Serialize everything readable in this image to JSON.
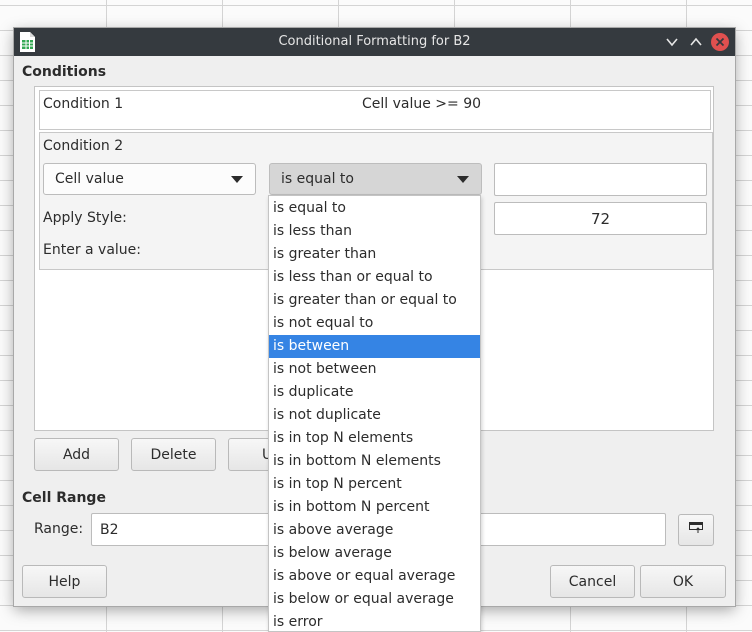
{
  "dialog": {
    "title": "Conditional Formatting for B2",
    "colors": {
      "titlebar": "#353a3f",
      "close": "#e0504f",
      "selection": "#3584e4"
    }
  },
  "conditions": {
    "heading": "Conditions",
    "condition1": {
      "label": "Condition 1",
      "summary": "Cell value >= 90"
    },
    "condition2": {
      "label": "Condition 2",
      "type_combo": "Cell value",
      "operator_combo": "is equal to",
      "value_field": "",
      "apply_style_label": "Apply Style:",
      "enter_value_label": "Enter a value:",
      "value2_field": "72"
    },
    "operator_options": [
      "is equal to",
      "is less than",
      "is greater than",
      "is less than or equal to",
      "is greater than or equal to",
      "is not equal to",
      "is between",
      "is not between",
      "is duplicate",
      "is not duplicate",
      "is in top N elements",
      "is in bottom N elements",
      "is in top N percent",
      "is in bottom N percent",
      "is above average",
      "is below average",
      "is above or equal average",
      "is below or equal average",
      "is error"
    ],
    "selected_option": "is between"
  },
  "actions": {
    "add": "Add",
    "delete": "Delete",
    "up_partial": "U"
  },
  "cell_range": {
    "heading": "Cell Range",
    "range_label": "Range:",
    "range_value": "B2"
  },
  "footer": {
    "help": "Help",
    "cancel": "Cancel",
    "ok": "OK"
  },
  "icons": {
    "app": "spreadsheet-app-icon",
    "minimize": "chevron-down-icon",
    "maximize": "chevron-up-icon",
    "close": "close-icon",
    "shrink": "shrink-dialog-icon"
  }
}
